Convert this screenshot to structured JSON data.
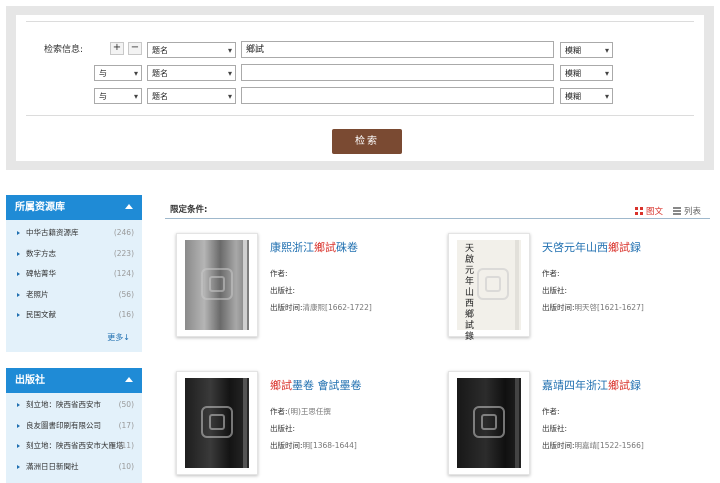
{
  "search": {
    "label": "检索信息:",
    "plus": "+",
    "minus": "−",
    "rows": [
      {
        "logic": "",
        "field": "题名",
        "value": "鄉試",
        "mode": "模糊"
      },
      {
        "logic": "与",
        "field": "题名",
        "value": "",
        "mode": "模糊"
      },
      {
        "logic": "与",
        "field": "题名",
        "value": "",
        "mode": "模糊"
      }
    ],
    "button": "检索"
  },
  "sidebar": {
    "resources": {
      "title": "所属资源库",
      "items": [
        {
          "label": "中华古籍资源库",
          "count": "(246)"
        },
        {
          "label": "数字方志",
          "count": "(223)"
        },
        {
          "label": "碑帖菁华",
          "count": "(124)"
        },
        {
          "label": "老照片",
          "count": "(56)"
        },
        {
          "label": "民国文献",
          "count": "(16)"
        }
      ],
      "more": "更多↓"
    },
    "publishers": {
      "title": "出版社",
      "items": [
        {
          "label": "刻立地：陕西省西安市",
          "count": "(50)"
        },
        {
          "label": "良友圖書印刷有限公司",
          "count": "(17)"
        },
        {
          "label": "刻立地：陕西省西安市大雁塔",
          "count": "(11)"
        },
        {
          "label": "滿洲日日新聞社",
          "count": "(10)"
        }
      ]
    }
  },
  "results": {
    "conditions_label": "限定条件:",
    "view_grid": "图文",
    "view_list": "列表",
    "field_labels": {
      "author": "作者:",
      "publisher": "出版社:",
      "date": "出版时间:"
    },
    "items": [
      {
        "title_pre": "康熙浙江",
        "title_hl": "鄉試",
        "title_post": "硃卷",
        "author": "",
        "publisher": "",
        "date": "清康熙[1662-1722]"
      },
      {
        "title_pre": "天啓元年山西",
        "title_hl": "鄉試",
        "title_post": "録",
        "author": "",
        "publisher": "",
        "date": "明天啓[1621-1627]",
        "cover_text": "天啟元年山西鄉試錄"
      },
      {
        "title_pre": "",
        "title_hl": "鄉試",
        "title_post": "墨卷 會試墨卷",
        "author": "(明)王思任撰",
        "publisher": "",
        "date": "明[1368-1644]"
      },
      {
        "title_pre": "嘉靖四年浙江",
        "title_hl": "鄉試",
        "title_post": "録",
        "author": "",
        "publisher": "",
        "date": "明嘉靖[1522-1566]"
      }
    ]
  },
  "colors": {
    "accent_blue": "#1f8bd6",
    "button_brown": "#7a4a32",
    "highlight_red": "#d9322b",
    "panel_bg": "#e3f1fa"
  }
}
